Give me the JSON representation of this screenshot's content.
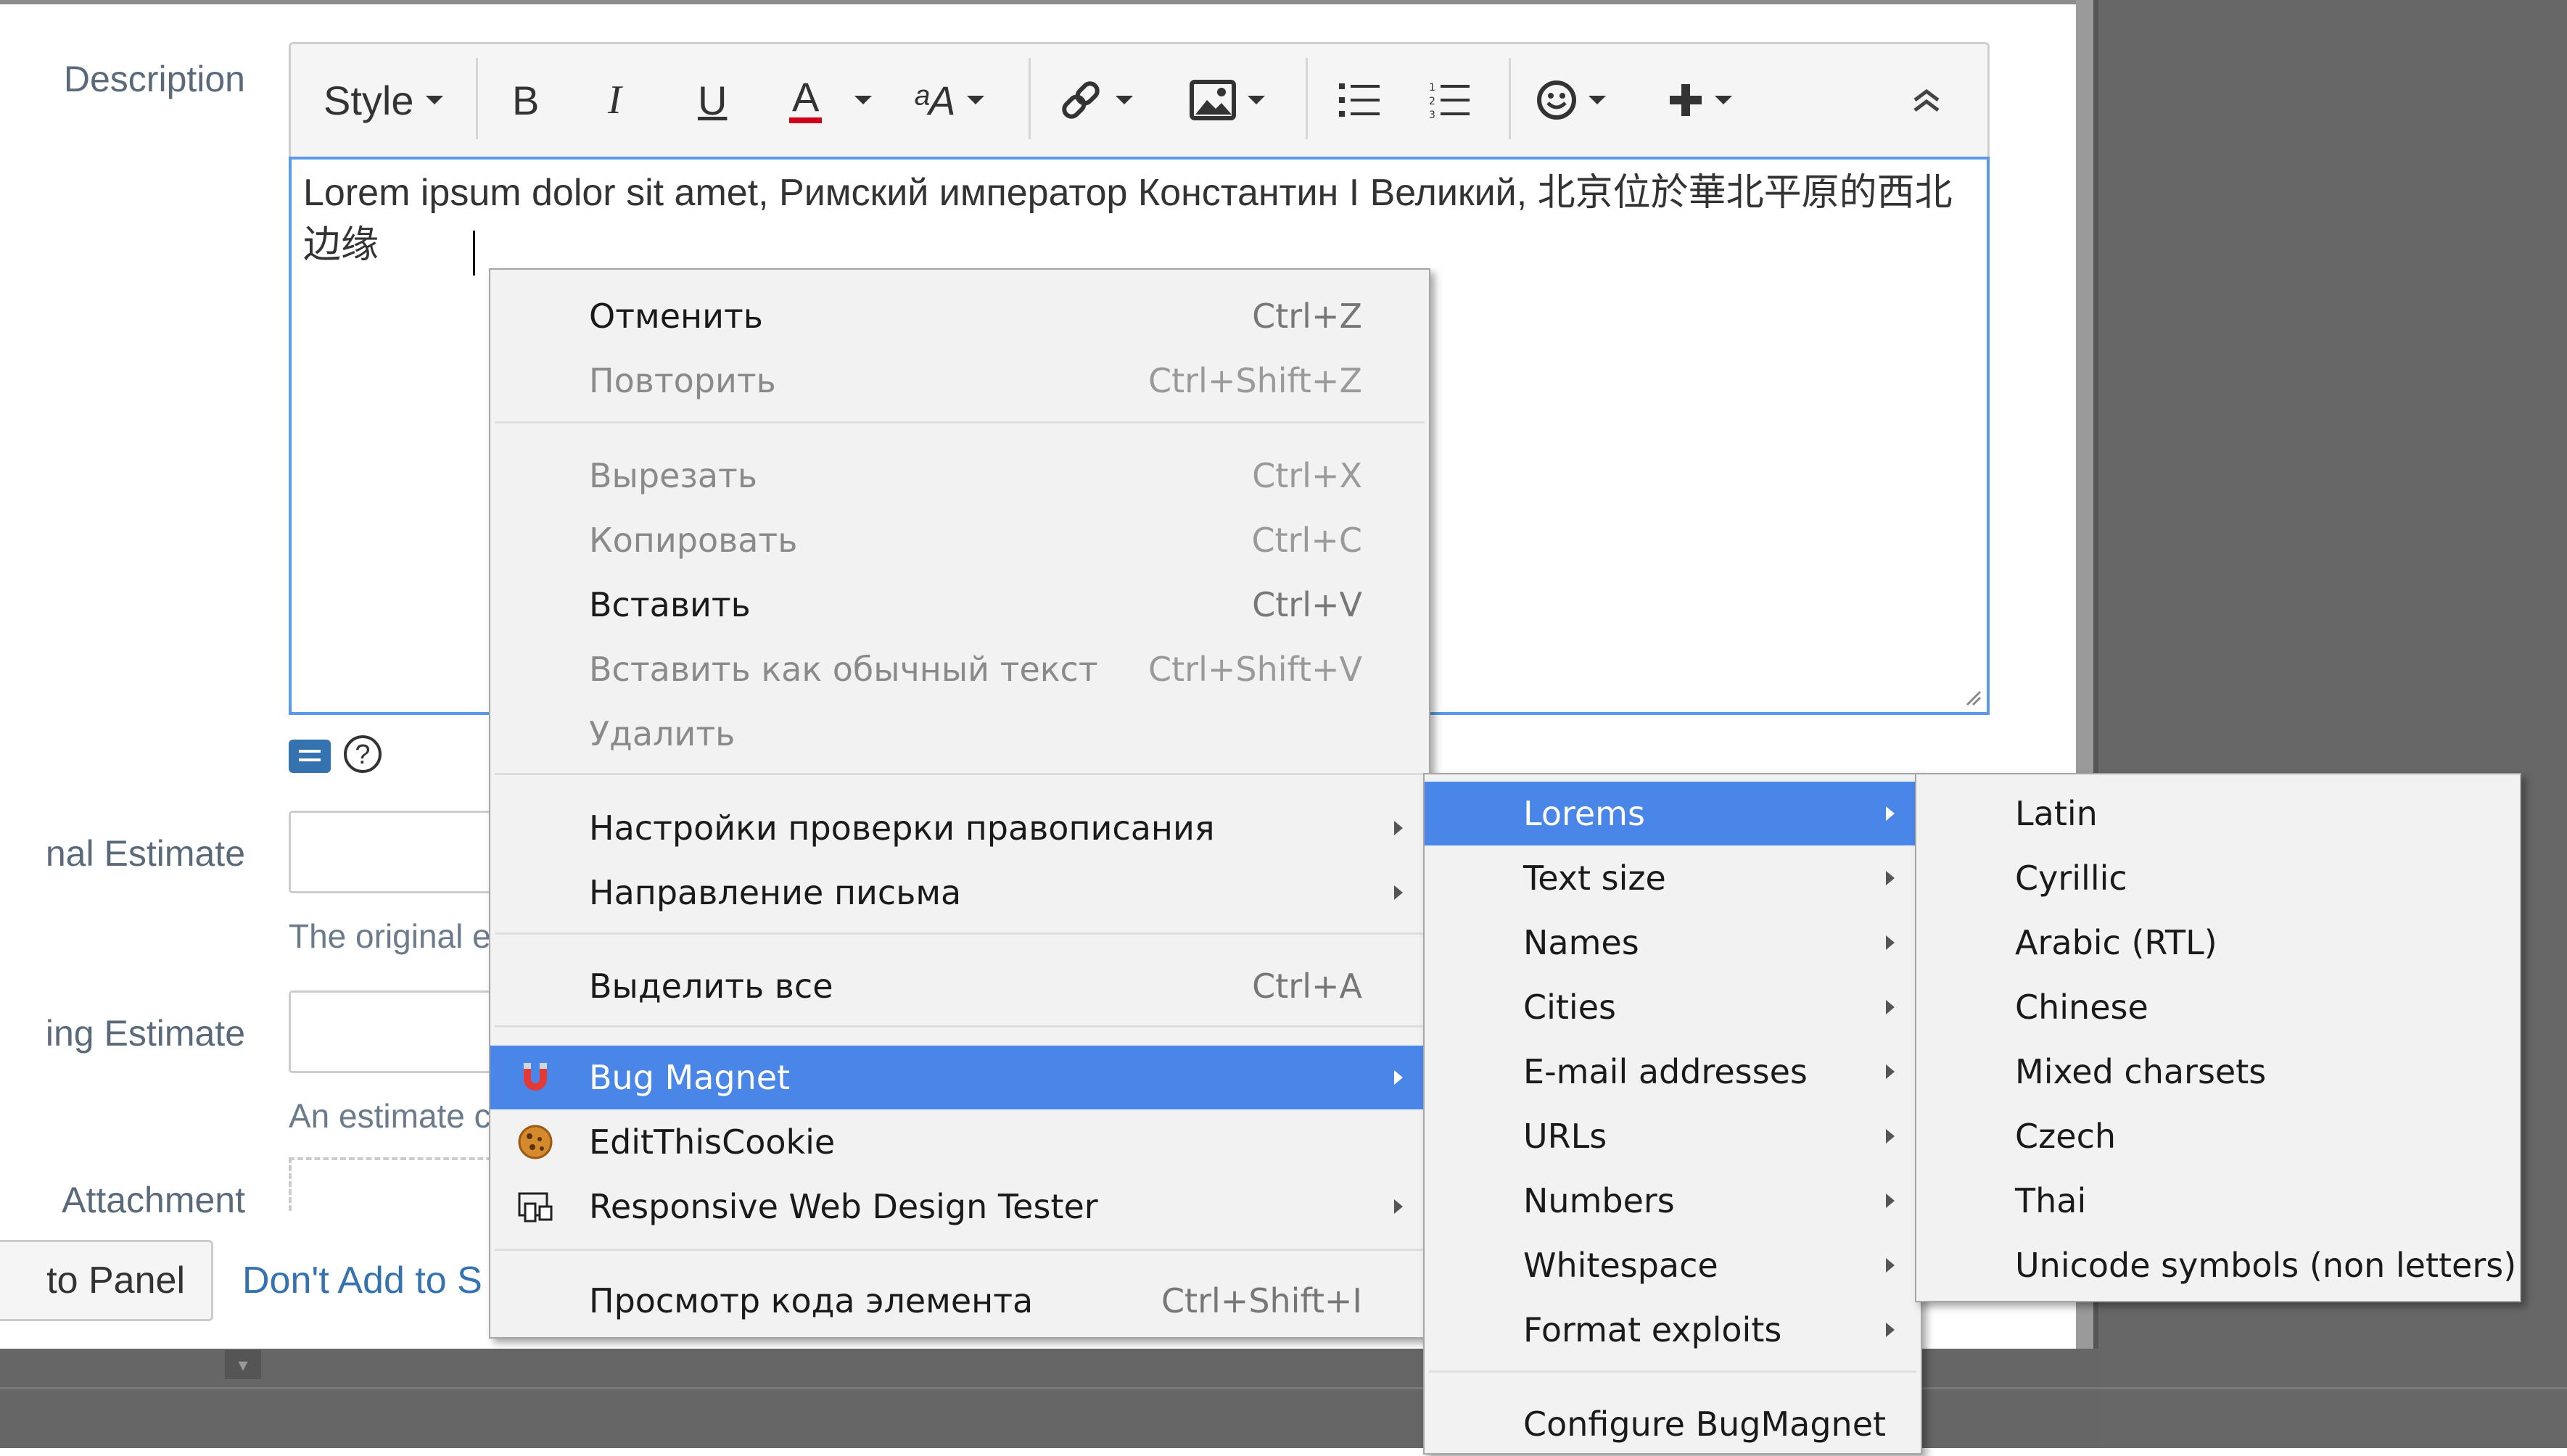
{
  "form": {
    "description_label": "Description",
    "original_estimate_label": "nal Estimate",
    "original_estimate_desc": "The original e",
    "remaining_estimate_label": "ing Estimate",
    "remaining_estimate_desc": "An estimate c",
    "attachment_label": "Attachment"
  },
  "toolbar": {
    "style_label": "Style",
    "bold": "B",
    "italic": "I",
    "underline": "U",
    "text_color": "A",
    "text_size": "ᵃA",
    "collapse": "≈"
  },
  "editor": {
    "text": "Lorem ipsum dolor sit amet, Римский император Константин I Великий, 北京位於華北平原的西北边缘 "
  },
  "buttons": {
    "add_to_panel": "to Panel",
    "dont_add": "Don't Add to S"
  },
  "context_menu": {
    "items": [
      {
        "label": "Отменить",
        "shortcut": "Ctrl+Z",
        "disabled": false
      },
      {
        "label": "Повторить",
        "shortcut": "Ctrl+Shift+Z",
        "disabled": true
      },
      {
        "label": "Вырезать",
        "shortcut": "Ctrl+X",
        "disabled": true
      },
      {
        "label": "Копировать",
        "shortcut": "Ctrl+C",
        "disabled": true
      },
      {
        "label": "Вставить",
        "shortcut": "Ctrl+V",
        "disabled": false
      },
      {
        "label": "Вставить как обычный текст",
        "shortcut": "Ctrl+Shift+V",
        "disabled": true
      },
      {
        "label": "Удалить",
        "shortcut": "",
        "disabled": true
      },
      {
        "label": "Настройки проверки правописания",
        "shortcut": "",
        "submenu": true
      },
      {
        "label": "Направление письма",
        "shortcut": "",
        "submenu": true
      },
      {
        "label": "Выделить все",
        "shortcut": "Ctrl+A"
      },
      {
        "label": "Bug Magnet",
        "submenu": true,
        "highlighted": true,
        "icon": "magnet-icon"
      },
      {
        "label": "EditThisCookie",
        "icon": "cookie-icon"
      },
      {
        "label": "Responsive Web Design Tester",
        "submenu": true,
        "icon": "device-icon"
      },
      {
        "label": "Просмотр кода элемента",
        "shortcut": "Ctrl+Shift+I"
      }
    ]
  },
  "bugmagnet_menu": {
    "items": [
      "Lorems",
      "Text size",
      "Names",
      "Cities",
      "E-mail addresses",
      "URLs",
      "Numbers",
      "Whitespace",
      "Format exploits"
    ],
    "configure": "Configure BugMagnet"
  },
  "lorems_menu": {
    "items": [
      "Latin",
      "Cyrillic",
      "Arabic (RTL)",
      "Chinese",
      "Mixed charsets",
      "Czech",
      "Thai",
      "Unicode symbols (non letters)"
    ]
  },
  "colors": {
    "highlight": "#4a86e8",
    "editor_border": "#5b9ae8",
    "link": "#3572b0",
    "text_color_underline": "#d0021b"
  }
}
